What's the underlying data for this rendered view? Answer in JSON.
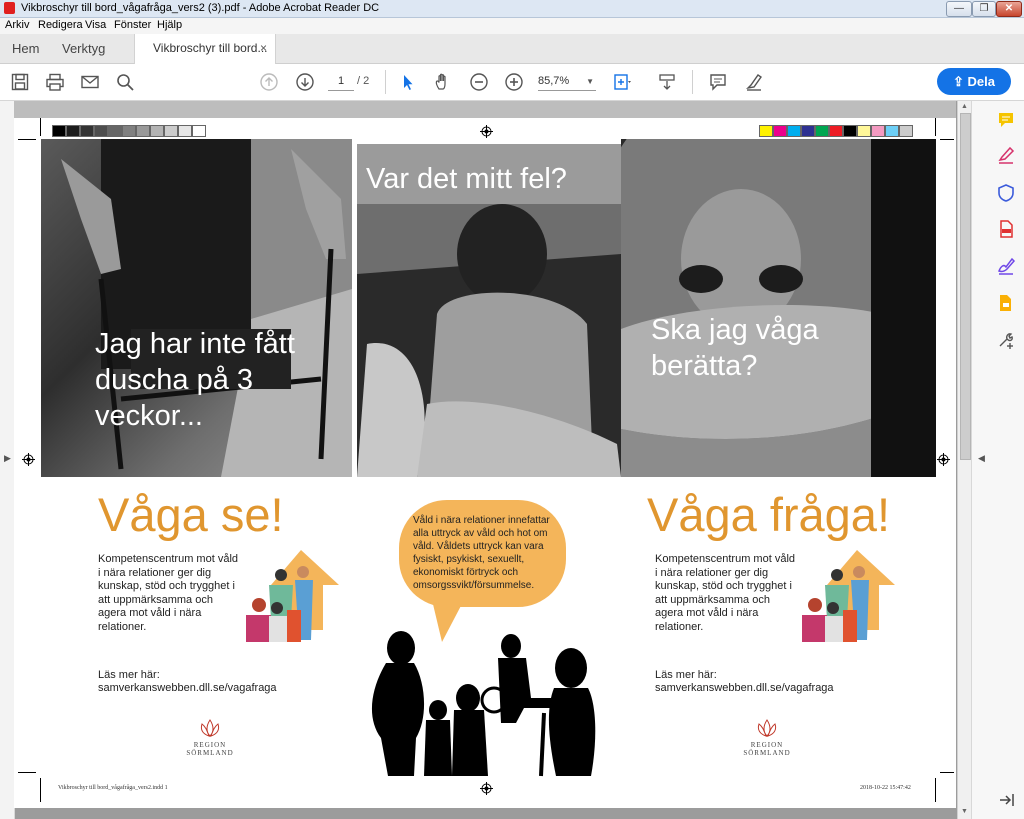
{
  "window": {
    "title": "Vikbroschyr till bord_vågafråga_vers2 (3).pdf - Adobe Acrobat Reader DC",
    "minimize": "—",
    "restore": "❐",
    "close": "✕"
  },
  "menu": [
    "Arkiv",
    "Redigera",
    "Visa",
    "Fönster",
    "Hjälp"
  ],
  "tabs": {
    "home": "Hem",
    "tools": "Verktyg",
    "doc": "Vikbroschyr till bord...",
    "close": "×"
  },
  "toolbar": {
    "page_current": "1",
    "page_total": "/ 2",
    "zoom": "85,7%",
    "share": "Dela"
  },
  "document": {
    "quotes": {
      "q1": "Jag har inte fått duscha på 3 veckor...",
      "q2": "Var det mitt fel?",
      "q3": "Ska jag våga berätta?"
    },
    "left": {
      "heading": "Våga se!",
      "body": "Kompetenscentrum mot våld i nära relationer ger dig kunskap, stöd och trygghet i att uppmärksamma och agera mot våld i nära relationer.",
      "more_label": "Läs mer här:",
      "more_url": "samverkanswebben.dll.se/vagafraga"
    },
    "right": {
      "heading": "Våga fråga!",
      "body": "Kompetenscentrum mot våld i nära relationer ger dig kunskap, stöd och trygghet i att uppmärksamma och agera mot våld i nära relationer.",
      "more_label": "Läs mer här:",
      "more_url": "samverkanswebben.dll.se/vagafraga"
    },
    "bubble": "Våld i nära relationer innefattar alla uttryck av våld och hot om våld. Våldets uttryck kan vara fysiskt, psykiskt, sexuellt, ekonomiskt förtryck och omsorgssvikt/försummelse.",
    "logo": {
      "line1": "REGION",
      "line2": "SÖRMLAND"
    },
    "footer_left": "Vikbroschyr till bord_vågafråga_vers2.indd   1",
    "footer_right": "2018-10-22   15:47:42"
  },
  "colors": {
    "accent": "#e0962f",
    "bubble": "#f4b55a",
    "share": "#1473e6"
  },
  "right_pane_icons": [
    "comment-icon",
    "fill-sign-icon",
    "protect-icon",
    "export-pdf-icon",
    "edit-sign-icon",
    "organize-icon",
    "more-tools-icon",
    "collapse-pane-icon"
  ]
}
